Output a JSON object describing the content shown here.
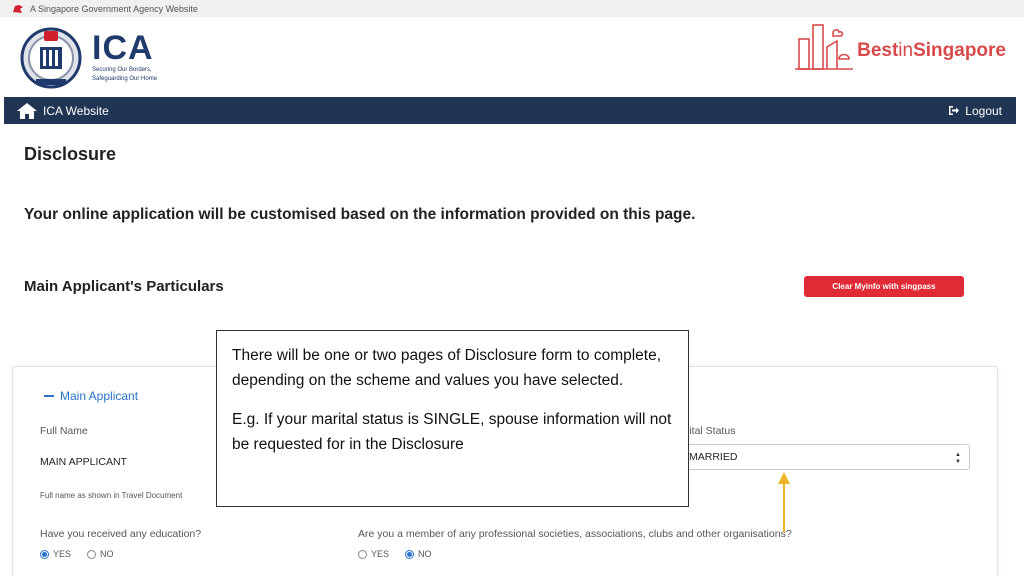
{
  "gov_bar": {
    "text": "A Singapore Government Agency Website"
  },
  "ica": {
    "name": "ICA",
    "tagline_1": "Securing Our Borders,",
    "tagline_2": "Safeguarding Our Home"
  },
  "watermark": {
    "part1": "Best",
    "part2": "in",
    "part3": "Singapore"
  },
  "nav": {
    "home_label": "ICA Website",
    "logout_label": "Logout"
  },
  "page": {
    "title": "Disclosure",
    "intro": "Your online application will be customised based on the information provided on this page.",
    "section_title": "Main Applicant's Particulars",
    "clear_button": "Clear Myinfo with singpass"
  },
  "form": {
    "applicant_toggle": "Main Applicant",
    "full_name_label": "Full Name",
    "full_name_value": "MAIN APPLICANT",
    "full_name_hint": "Full name as shown in Travel Document",
    "marital_label": "arital Status",
    "marital_value": "MARRIED",
    "education_question": "Have you received any education?",
    "education_yes": "YES",
    "education_no": "NO",
    "education_selected": "YES",
    "member_question": "Are you a member of any professional societies, associations, clubs and other organisations?",
    "member_yes": "YES",
    "member_no": "NO",
    "member_selected": "NO"
  },
  "callout": {
    "paragraph_1": "There will be one or two pages of Disclosure form to complete, depending on the scheme and values you have selected.",
    "paragraph_2": "E.g. If your marital status is SINGLE, spouse information will not be requested for in the Disclosure"
  },
  "colors": {
    "navbar": "#1f3553",
    "clear_button": "#e02b36",
    "accent_blue": "#2a73c9",
    "arrow": "#f0b429",
    "watermark": "#d84a4a"
  }
}
